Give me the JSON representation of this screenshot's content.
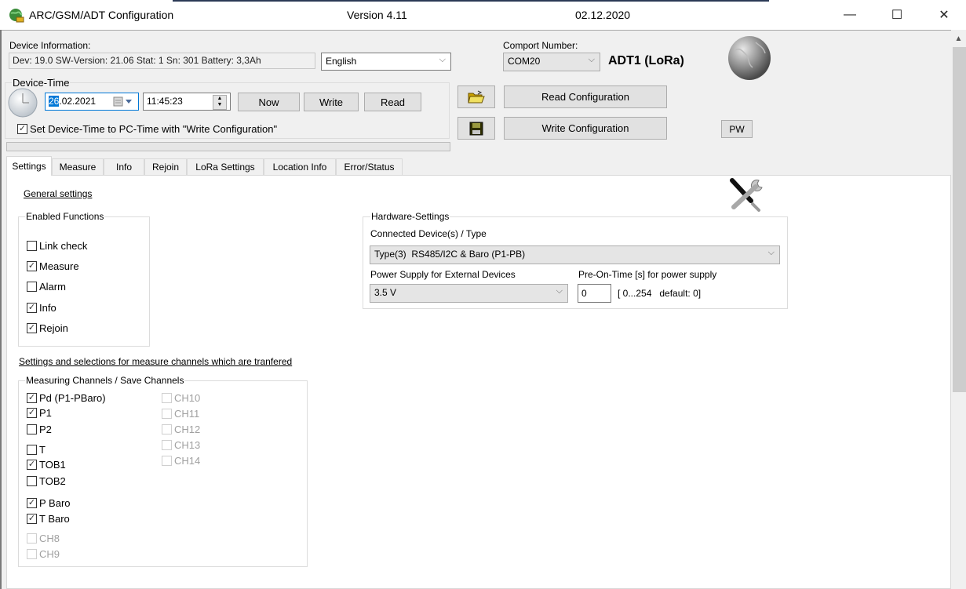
{
  "window": {
    "title": "ARC/GSM/ADT Configuration",
    "version": "Version 4.11",
    "date": "02.12.2020",
    "controls": {
      "minimize": "—",
      "maximize": "☐",
      "close": "✕"
    }
  },
  "device_info": {
    "label": "Device Information:",
    "value": "Dev: 19.0 SW-Version: 21.06 Stat: 1 Sn: 301 Battery: 3,3Ah",
    "language": "English"
  },
  "comport": {
    "label": "Comport Number:",
    "value": "COM20",
    "device_name": "ADT1 (LoRa)"
  },
  "device_time": {
    "group_label": "Device-Time",
    "date_selected_part": "26",
    "date_rest": ".02.2021",
    "time": "11:45:23",
    "now_button": "Now",
    "write_button": "Write",
    "read_button": "Read",
    "sync_checkbox": {
      "label": "Set Device-Time to PC-Time with \"Write Configuration\"",
      "checked": true
    }
  },
  "progress": {
    "value_percent": 0
  },
  "config_buttons": {
    "read": "Read Configuration",
    "write": "Write Configuration",
    "pw": "PW"
  },
  "tabs": [
    {
      "label": "Settings",
      "active": true
    },
    {
      "label": "Measure",
      "active": false
    },
    {
      "label": "Info",
      "active": false
    },
    {
      "label": "Rejoin",
      "active": false
    },
    {
      "label": "LoRa Settings",
      "active": false
    },
    {
      "label": "Location Info",
      "active": false
    },
    {
      "label": "Error/Status",
      "active": false
    }
  ],
  "settings": {
    "general_heading": "General settings",
    "enabled_functions": {
      "title": "Enabled Functions",
      "items": [
        {
          "label": "Link check",
          "checked": false
        },
        {
          "label": "Measure",
          "checked": true
        },
        {
          "label": "Alarm",
          "checked": false
        },
        {
          "label": "Info",
          "checked": true
        },
        {
          "label": "Rejoin",
          "checked": true
        }
      ]
    },
    "hardware": {
      "title": "Hardware-Settings",
      "device_type_label": "Connected Device(s) / Type",
      "device_type_value": "Type(3)  RS485/I2C & Baro (P1-PB)",
      "power_label": "Power Supply for External Devices",
      "power_value": "3.5 V",
      "preon_label": "Pre-On-Time [s] for power supply",
      "preon_value": "0",
      "preon_hint": "[ 0...254   default: 0]"
    },
    "channels_heading": "Settings and selections for measure channels which are tranfered",
    "channels": {
      "title": "Measuring Channels / Save Channels",
      "col1": [
        {
          "label": "Pd (P1-PBaro)",
          "checked": true,
          "enabled": true
        },
        {
          "label": "P1",
          "checked": true,
          "enabled": true
        },
        {
          "label": "P2",
          "checked": false,
          "enabled": true
        },
        {
          "label": "T",
          "checked": false,
          "enabled": true
        },
        {
          "label": "TOB1",
          "checked": true,
          "enabled": true
        },
        {
          "label": "TOB2",
          "checked": false,
          "enabled": true
        },
        {
          "label": "P Baro",
          "checked": true,
          "enabled": true
        },
        {
          "label": "T Baro",
          "checked": true,
          "enabled": true
        },
        {
          "label": "CH8",
          "checked": false,
          "enabled": false
        },
        {
          "label": "CH9",
          "checked": false,
          "enabled": false
        }
      ],
      "col2": [
        {
          "label": "CH10",
          "checked": false,
          "enabled": false
        },
        {
          "label": "CH11",
          "checked": false,
          "enabled": false
        },
        {
          "label": "CH12",
          "checked": false,
          "enabled": false
        },
        {
          "label": "CH13",
          "checked": false,
          "enabled": false
        },
        {
          "label": "CH14",
          "checked": false,
          "enabled": false
        }
      ]
    }
  },
  "icons": {
    "app": "globe-app-icon",
    "globe": "globe-icon",
    "clock": "clock-icon",
    "open": "folder-open-icon",
    "save": "floppy-disk-icon",
    "tools": "tools-icon",
    "calendar": "calendar-icon",
    "checkmark": "✓",
    "chevron": "⌵",
    "scroll_up": "▲"
  }
}
